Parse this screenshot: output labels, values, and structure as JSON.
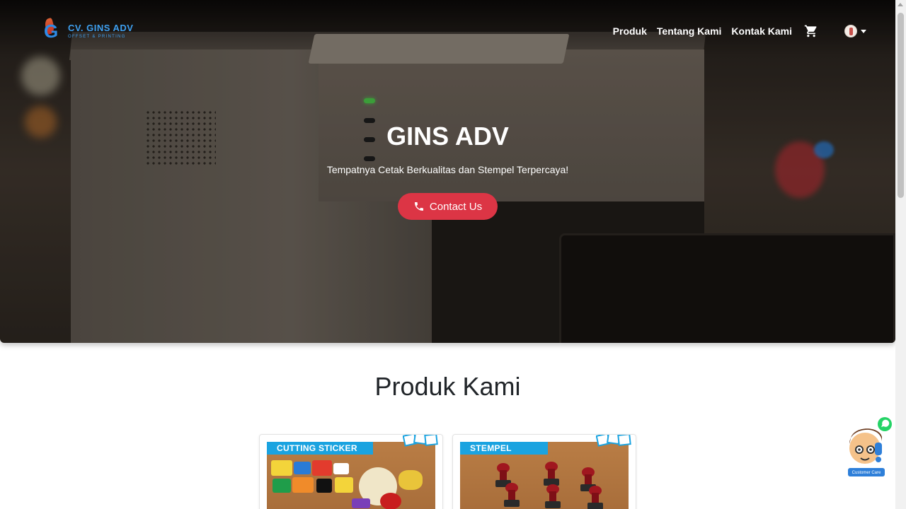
{
  "brand": {
    "title": "CV. GINS ADV",
    "subtitle": "OFFSET & PRINTING",
    "colors": {
      "primary": "#3ea0f0",
      "accent": "#dc3545"
    }
  },
  "nav": {
    "links": [
      "Produk",
      "Tentang Kami",
      "Kontak Kami"
    ],
    "cart_icon": "shopping-cart-icon",
    "user_icon": "user-avatar"
  },
  "hero": {
    "title": "GINS ADV",
    "subtitle": "Tempatnya Cetak Berkualitas dan Stempel Terpercaya!",
    "button_label": "Contact Us",
    "button_icon": "phone-icon"
  },
  "products": {
    "heading": "Produk Kami",
    "items": [
      {
        "label": "CUTTING STICKER"
      },
      {
        "label": "STEMPEL"
      }
    ]
  },
  "customer_care": {
    "label": "Customer Care",
    "icon": "whatsapp-icon"
  }
}
